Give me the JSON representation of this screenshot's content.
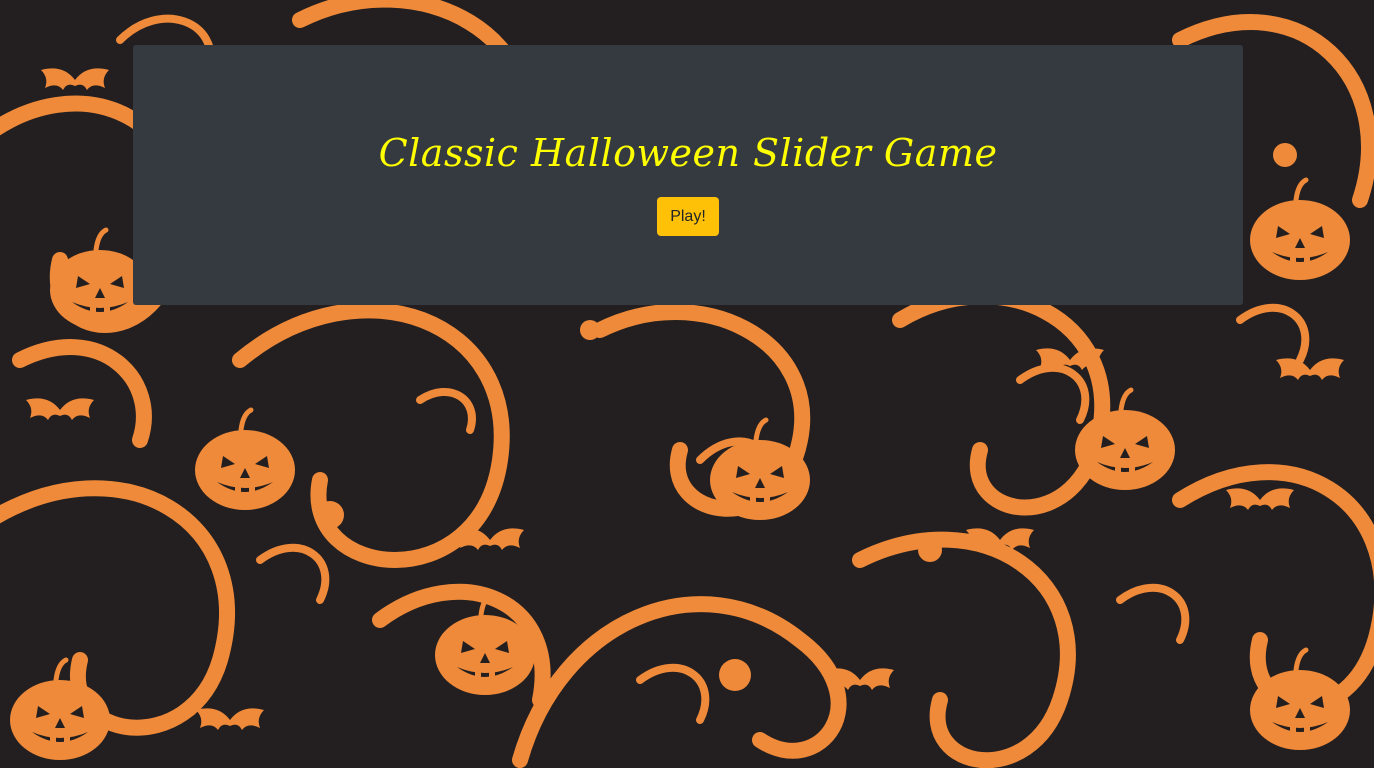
{
  "background": {
    "theme": "halloween-swirl-pattern",
    "motifs": [
      "jack-o-lantern",
      "bat",
      "swirl"
    ],
    "colors": {
      "orange": "#ef8a3a",
      "dark": "#231f20"
    }
  },
  "panel": {
    "color": "#343a40",
    "title": "Classic Halloween Slider Game",
    "title_color": "#ffff00",
    "play_label": "Play!",
    "play_color": "#ffc107"
  }
}
